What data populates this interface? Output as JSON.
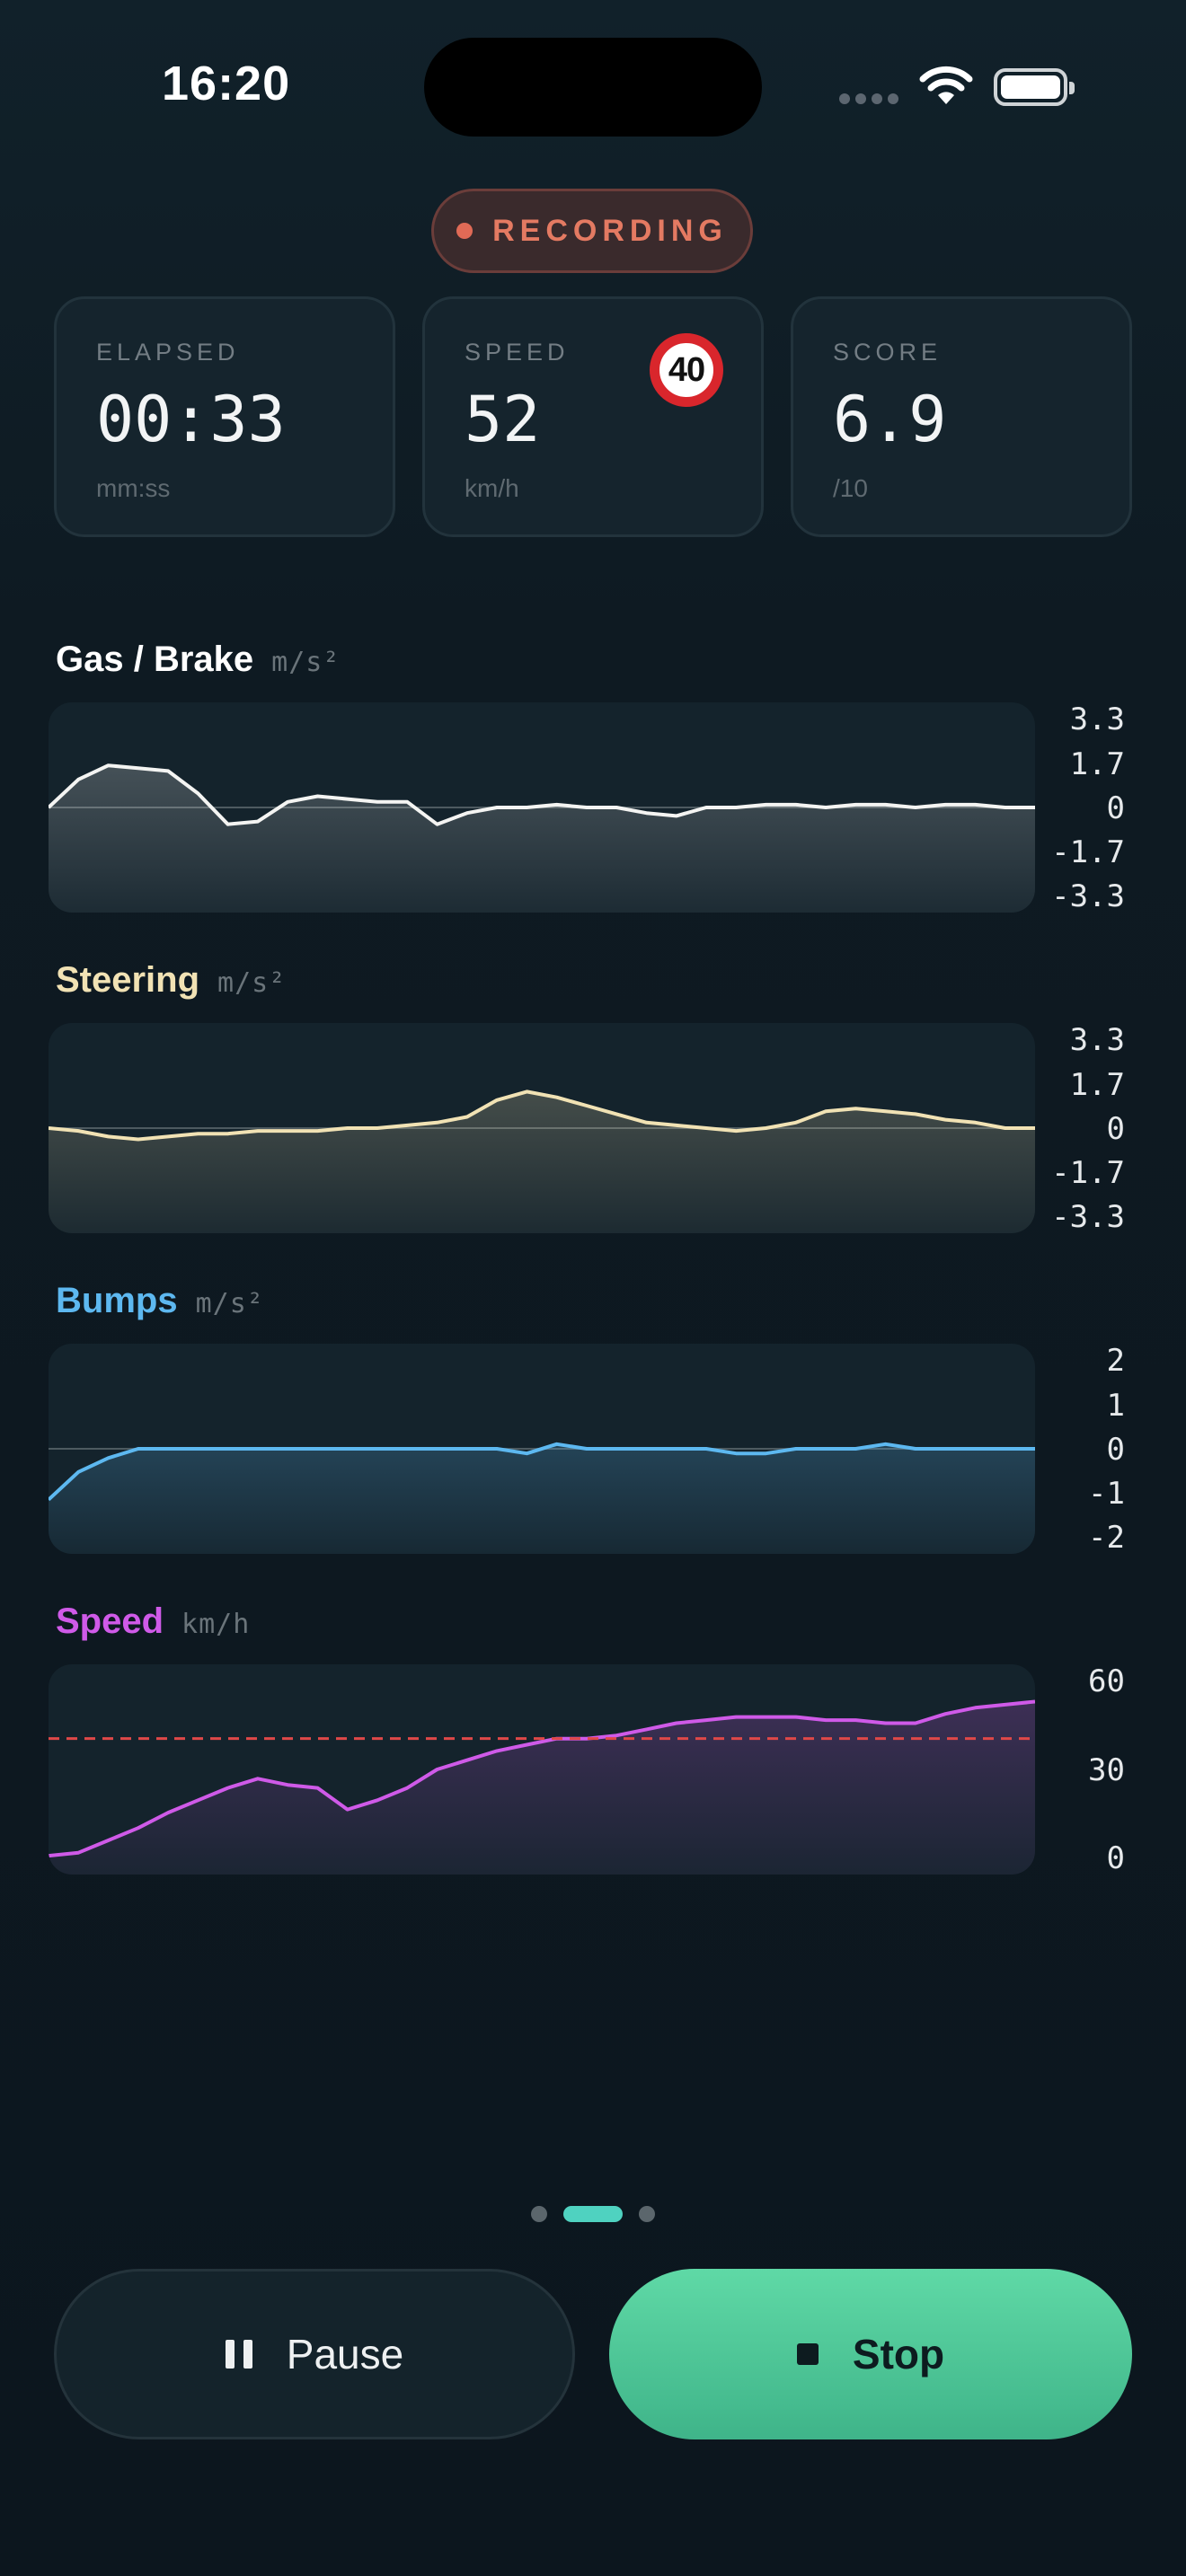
{
  "status_bar": {
    "time": "16:20"
  },
  "recording": {
    "label": "RECORDING",
    "color": "#e47a62"
  },
  "stats": {
    "elapsed": {
      "label": "ELAPSED",
      "value": "00:33",
      "unit": "mm:ss"
    },
    "speed": {
      "label": "SPEED",
      "value": "52",
      "unit": "km/h",
      "limit": "40"
    },
    "score": {
      "label": "SCORE",
      "value": "6.9",
      "unit": "/10"
    }
  },
  "charts": {
    "gas_brake": {
      "title": "Gas / Brake",
      "unit": "m/s²",
      "ticks": [
        "3.3",
        "1.7",
        "0",
        "-1.7",
        "-3.3"
      ],
      "color": "#f4f4f2"
    },
    "steering": {
      "title": "Steering",
      "unit": "m/s²",
      "ticks": [
        "3.3",
        "1.7",
        "0",
        "-1.7",
        "-3.3"
      ],
      "color": "#f1e2b4"
    },
    "bumps": {
      "title": "Bumps",
      "unit": "m/s²",
      "ticks": [
        "2",
        "1",
        "0",
        "-1",
        "-2"
      ],
      "color": "#5db8f0"
    },
    "speed": {
      "title": "Speed",
      "unit": "km/h",
      "ticks": [
        "60",
        "30",
        "0"
      ],
      "color": "#cf5ae8",
      "limit_line_color": "#e04848"
    }
  },
  "chart_data": [
    {
      "type": "area",
      "x": [
        0,
        1,
        2,
        3,
        4,
        5,
        6,
        7,
        8,
        9,
        10,
        11,
        12,
        13,
        14,
        15,
        16,
        17,
        18,
        19,
        20,
        21,
        22,
        23,
        24,
        25,
        26,
        27,
        28,
        29,
        30,
        31,
        32,
        33
      ],
      "series": [
        {
          "values": [
            0,
            1.0,
            1.5,
            1.4,
            1.3,
            0.5,
            -0.6,
            -0.5,
            0.2,
            0.4,
            0.3,
            0.2,
            0.2,
            -0.6,
            -0.2,
            0,
            0,
            0.1,
            0,
            0,
            -0.2,
            -0.3,
            0,
            0,
            0.1,
            0.1,
            0,
            0.1,
            0.1,
            0,
            0.1,
            0.1,
            0,
            0
          ]
        }
      ],
      "ylim": [
        -3.3,
        3.3
      ]
    },
    {
      "type": "area",
      "x": [
        0,
        1,
        2,
        3,
        4,
        5,
        6,
        7,
        8,
        9,
        10,
        11,
        12,
        13,
        14,
        15,
        16,
        17,
        18,
        19,
        20,
        21,
        22,
        23,
        24,
        25,
        26,
        27,
        28,
        29,
        30,
        31,
        32,
        33
      ],
      "series": [
        {
          "values": [
            0,
            -0.1,
            -0.3,
            -0.4,
            -0.3,
            -0.2,
            -0.2,
            -0.1,
            -0.1,
            -0.1,
            0,
            0,
            0.1,
            0.2,
            0.4,
            1.0,
            1.3,
            1.1,
            0.8,
            0.5,
            0.2,
            0.1,
            0,
            -0.1,
            0,
            0.2,
            0.6,
            0.7,
            0.6,
            0.5,
            0.3,
            0.2,
            0,
            0
          ]
        }
      ],
      "ylim": [
        -3.3,
        3.3
      ]
    },
    {
      "type": "area",
      "x": [
        0,
        1,
        2,
        3,
        4,
        5,
        6,
        7,
        8,
        9,
        10,
        11,
        12,
        13,
        14,
        15,
        16,
        17,
        18,
        19,
        20,
        21,
        22,
        23,
        24,
        25,
        26,
        27,
        28,
        29,
        30,
        31,
        32,
        33
      ],
      "series": [
        {
          "values": [
            -1.1,
            -0.5,
            -0.2,
            0,
            0,
            0,
            0,
            0,
            0,
            0,
            0,
            0,
            0,
            0,
            0,
            0,
            -0.1,
            0.1,
            0,
            0,
            0,
            0,
            0,
            -0.1,
            -0.1,
            0,
            0,
            0,
            0.1,
            0,
            0,
            0,
            0,
            0
          ]
        }
      ],
      "ylim": [
        -2,
        2
      ]
    },
    {
      "type": "area",
      "x": [
        0,
        1,
        2,
        3,
        4,
        5,
        6,
        7,
        8,
        9,
        10,
        11,
        12,
        13,
        14,
        15,
        16,
        17,
        18,
        19,
        20,
        21,
        22,
        23,
        24,
        25,
        26,
        27,
        28,
        29,
        30,
        31,
        32,
        33
      ],
      "series": [
        {
          "values": [
            2,
            3,
            7,
            11,
            16,
            20,
            24,
            27,
            25,
            24,
            17,
            20,
            24,
            30,
            33,
            36,
            38,
            40,
            40,
            41,
            43,
            45,
            46,
            47,
            47,
            47,
            46,
            46,
            45,
            45,
            48,
            50,
            51,
            52
          ]
        }
      ],
      "limit": 40,
      "ylim": [
        0,
        60
      ]
    }
  ],
  "pager": {
    "pages": 3,
    "active": 1
  },
  "controls": {
    "pause_label": "Pause",
    "stop_label": "Stop"
  }
}
